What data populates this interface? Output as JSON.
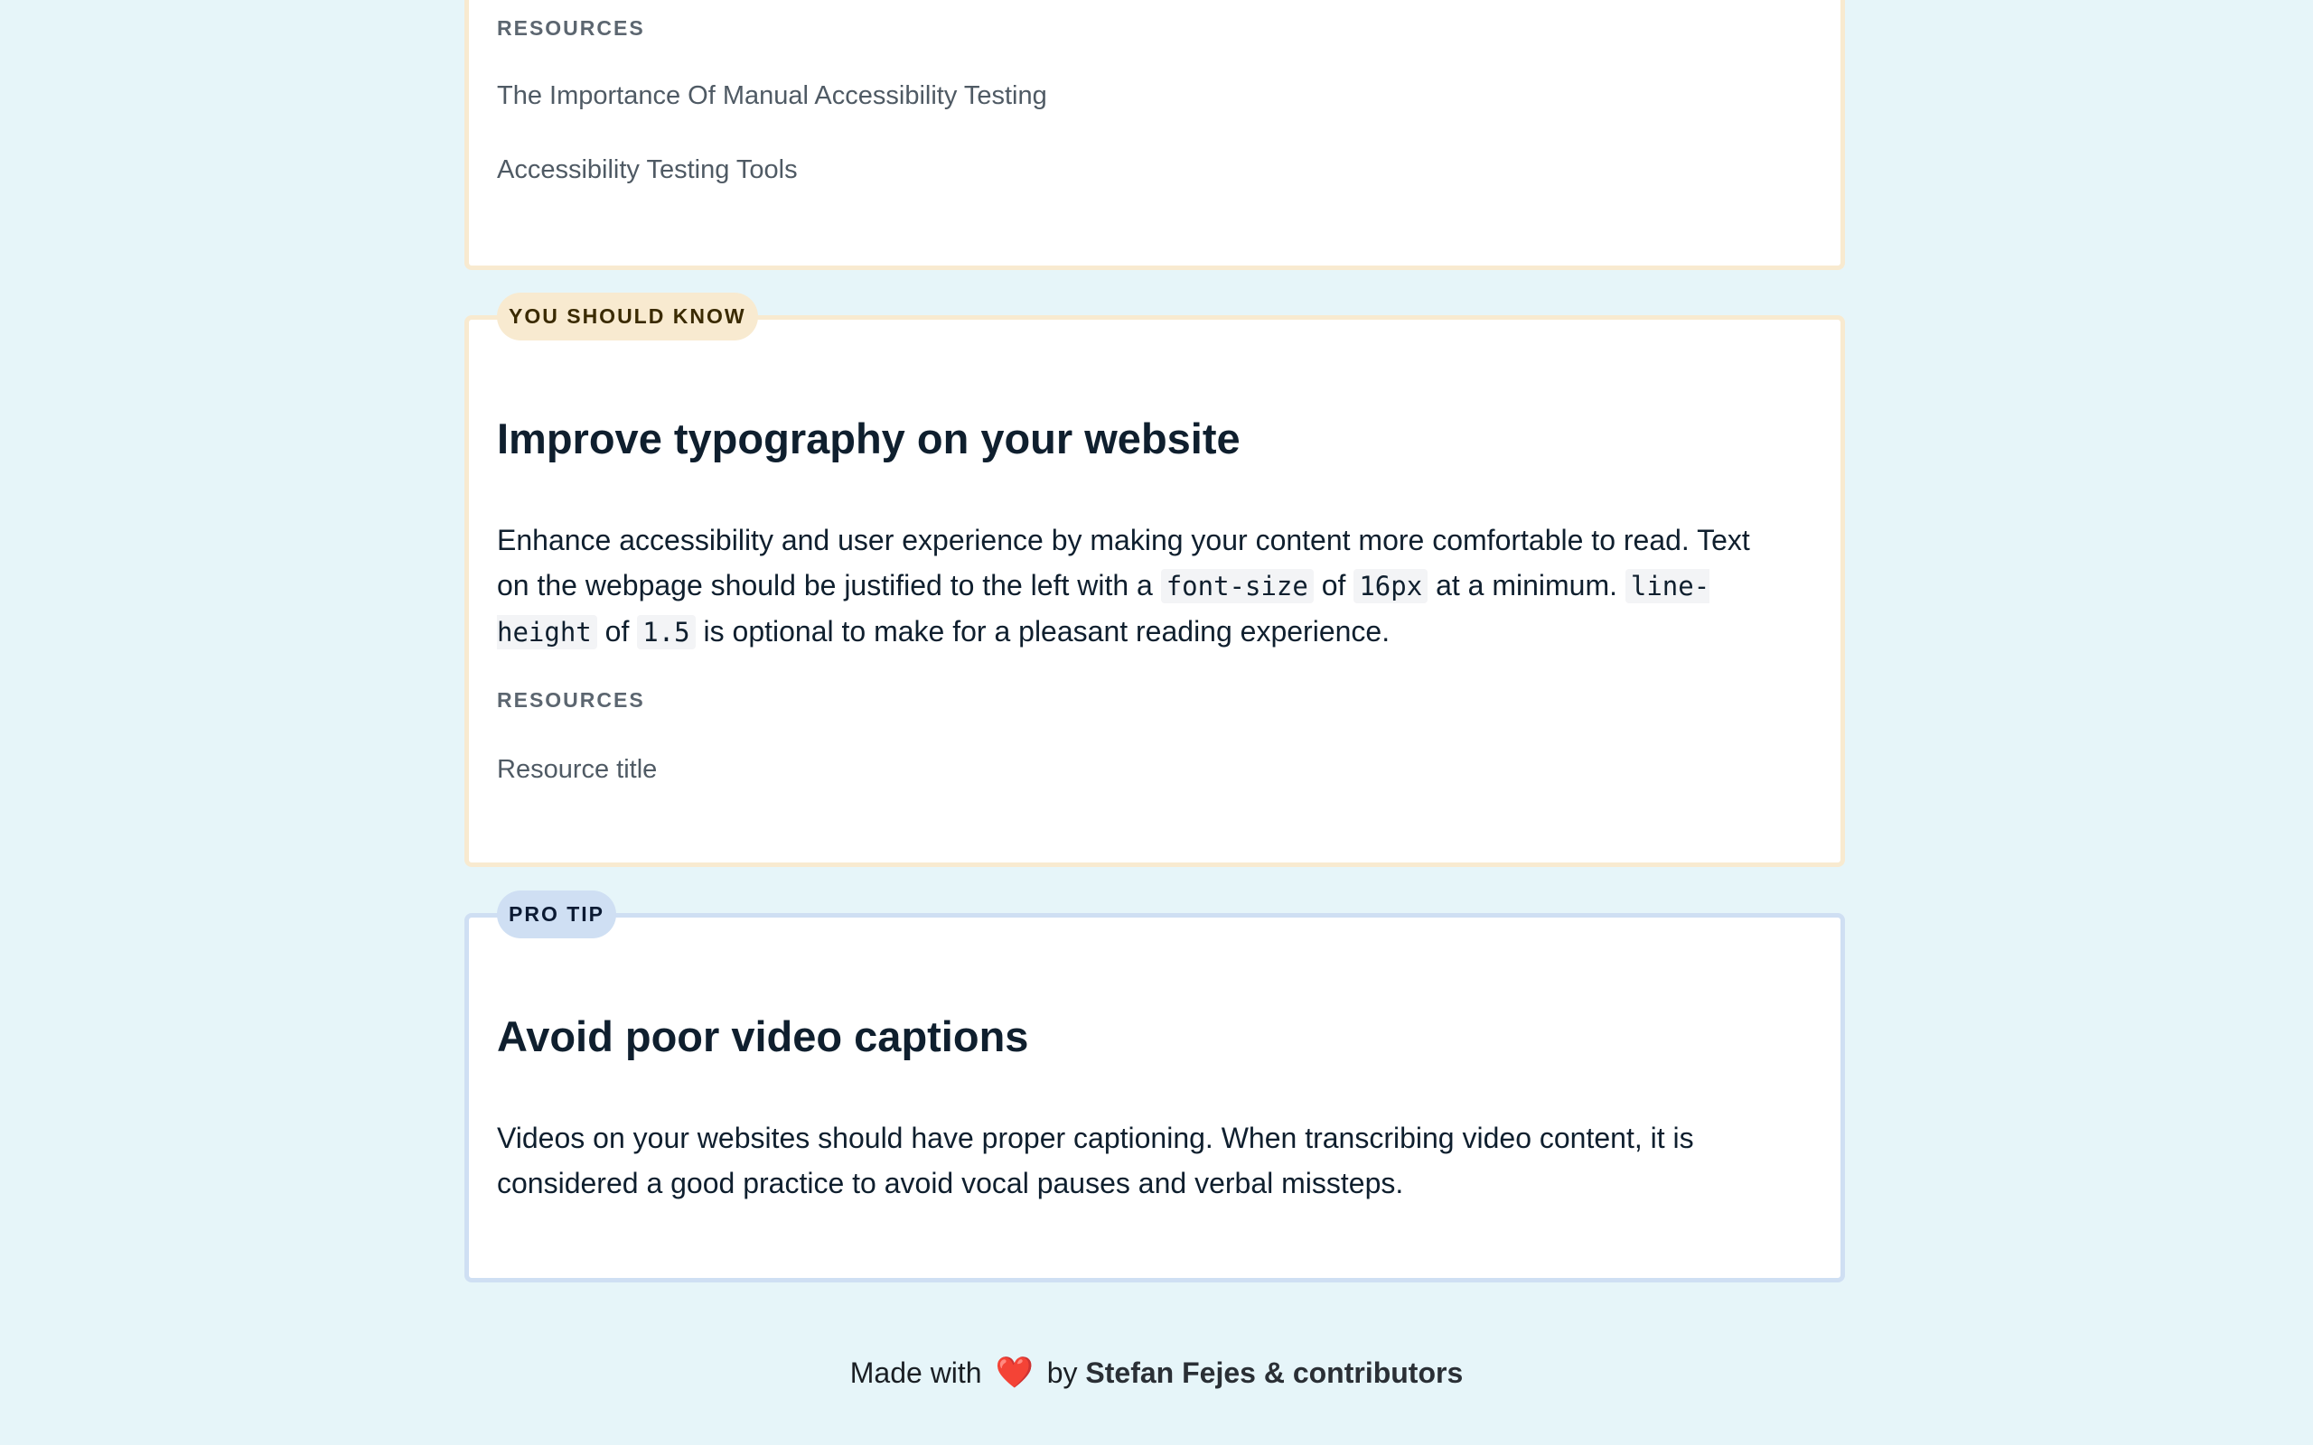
{
  "card1": {
    "resources_heading": "RESOURCES",
    "resources": [
      "The Importance Of Manual Accessibility Testing",
      "Accessibility Testing Tools"
    ]
  },
  "card2": {
    "badge": "YOU SHOULD KNOW",
    "title": "Improve typography on your website",
    "body": {
      "t1": "Enhance accessibility and user experience by making your content more comfortable to read. Text on the webpage should be justified to the left with a ",
      "c1": "font-size",
      "t2": " of ",
      "c2": "16px",
      "t3": " at a minimum. ",
      "c3": "line-height",
      "t4": " of ",
      "c4": "1.5",
      "t5": " is optional to make for a pleasant reading experience."
    },
    "resources_heading": "RESOURCES",
    "resources": [
      "Resource title"
    ]
  },
  "card3": {
    "badge": "PRO TIP",
    "title": "Avoid poor video captions",
    "body": "Videos on your websites should have proper captioning. When transcribing video content, it is considered a good practice to avoid vocal pauses and verbal missteps."
  },
  "footer": {
    "made_with": "Made with",
    "heart": "❤️",
    "by": "by",
    "author": "Stefan Fejes & contributors"
  },
  "colors": {
    "page_background": "#e6f5f9",
    "know_accent": "#f8ead0",
    "pro_accent": "#cfdff3",
    "heart": "#e0242a"
  }
}
